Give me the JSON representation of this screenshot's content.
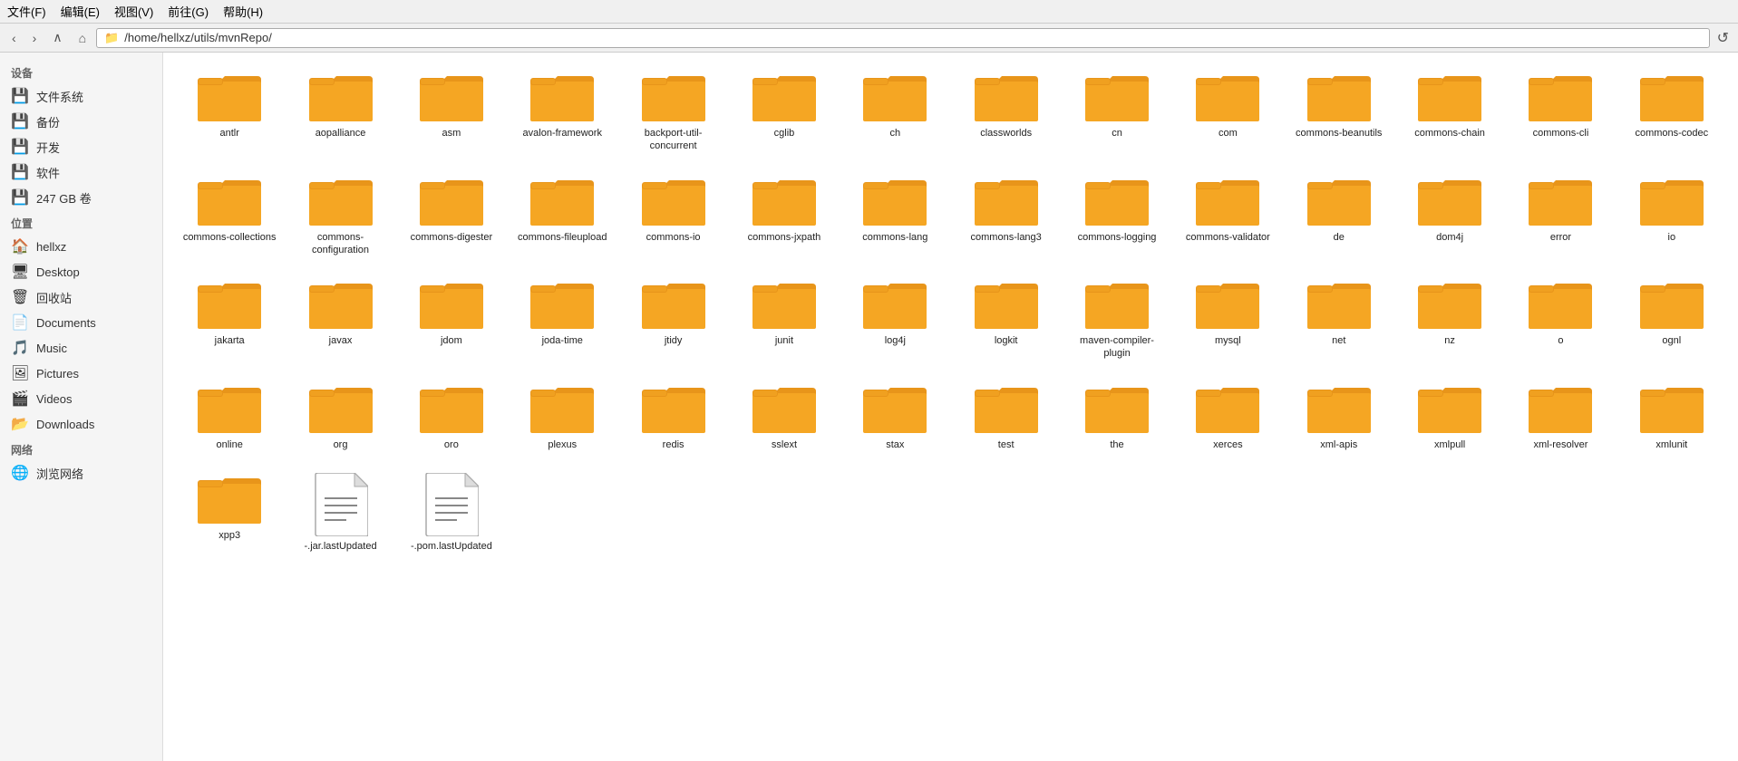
{
  "menubar": {
    "items": [
      "文件(F)",
      "编辑(E)",
      "视图(V)",
      "前往(G)",
      "帮助(H)"
    ]
  },
  "toolbar": {
    "back_label": "‹",
    "forward_label": "›",
    "up_label": "∧",
    "home_label": "⌂",
    "address": "/home/hellxz/utils/mvnRepo/",
    "reload_label": "↺"
  },
  "sidebar": {
    "sections": [
      {
        "title": "设备",
        "items": [
          {
            "label": "文件系统",
            "icon": "💾"
          },
          {
            "label": "备份",
            "icon": "💾"
          },
          {
            "label": "开发",
            "icon": "💾"
          },
          {
            "label": "软件",
            "icon": "💾"
          },
          {
            "label": "247 GB 卷",
            "icon": "💾"
          }
        ]
      },
      {
        "title": "位置",
        "items": [
          {
            "label": "hellxz",
            "icon": "🏠"
          },
          {
            "label": "Desktop",
            "icon": "🖥"
          },
          {
            "label": "回收站",
            "icon": "🗑"
          },
          {
            "label": "Documents",
            "icon": "📄"
          },
          {
            "label": "Music",
            "icon": "🎵"
          },
          {
            "label": "Pictures",
            "icon": "🖼"
          },
          {
            "label": "Videos",
            "icon": "🎬"
          },
          {
            "label": "Downloads",
            "icon": "📂"
          }
        ]
      },
      {
        "title": "网络",
        "items": [
          {
            "label": "浏览网络",
            "icon": "🌐"
          }
        ]
      }
    ]
  },
  "files": {
    "folders": [
      "antlr",
      "aopalliance",
      "asm",
      "avalon-framework",
      "backport-util-concurrent",
      "cglib",
      "ch",
      "classworlds",
      "cn",
      "com",
      "commons-beanutils",
      "commons-chain",
      "commons-cli",
      "commons-codec",
      "commons-collections",
      "commons-configuration",
      "commons-digester",
      "commons-fileupload",
      "commons-io",
      "commons-jxpath",
      "commons-lang",
      "commons-lang3",
      "commons-logging",
      "commons-validator",
      "de",
      "dom4j",
      "error",
      "io",
      "jakarta",
      "javax",
      "jdom",
      "joda-time",
      "jtidy",
      "junit",
      "log4j",
      "logkit",
      "maven-compiler-plugin",
      "mysql",
      "net",
      "nz",
      "o",
      "ognl",
      "online",
      "org",
      "oro",
      "plexus",
      "redis",
      "sslext",
      "stax",
      "test",
      "the",
      "xerces",
      "xml-apis",
      "xmlpull",
      "xml-resolver",
      "xmlunit",
      "xpp3"
    ],
    "files": [
      "-.jar.lastUpdated",
      "-.pom.lastUpdated"
    ]
  }
}
